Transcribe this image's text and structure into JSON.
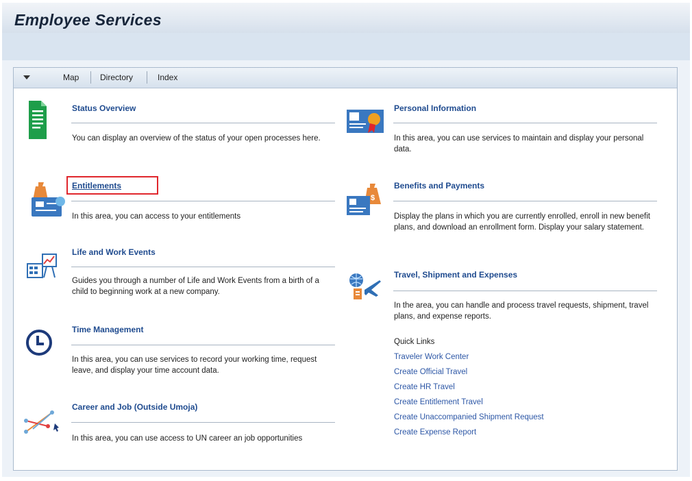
{
  "page": {
    "title": "Employee Services"
  },
  "toolbar": {
    "items": [
      "Map",
      "Directory",
      "Index"
    ]
  },
  "services_left": [
    {
      "title": "Status Overview",
      "desc": "You can display an overview of the status of your open processes here."
    },
    {
      "title": "Entitlements",
      "desc": "In this area, you can access to your entitlements"
    },
    {
      "title": "Life and Work Events",
      "desc": "Guides you through a number of Life and Work Events from a birth of a child to beginning work at a new company."
    },
    {
      "title": "Time Management",
      "desc": "In this area, you can use services to record your working time, request leave, and display your time account data."
    },
    {
      "title": "Career and Job (Outside Umoja)",
      "desc": "In this area, you can use access to UN career an job opportunities"
    }
  ],
  "services_right": [
    {
      "title": "Personal Information",
      "desc": "In this area, you can use services to maintain and display your personal data."
    },
    {
      "title": "Benefits and Payments",
      "desc": "Display the plans in which you are currently enrolled, enroll in new benefit plans, and download an enrollment form. Display your salary statement."
    },
    {
      "title": "Travel, Shipment and Expenses",
      "desc": "In the area, you can handle and process travel requests, shipment, travel plans, and expense reports."
    }
  ],
  "quick_links": {
    "label": "Quick Links",
    "items": [
      "Traveler Work Center",
      "Create Official Travel",
      "Create HR Travel",
      "Create Entitlement Travel",
      "Create Unaccompanied Shipment Request",
      "Create Expense Report"
    ]
  },
  "colors": {
    "link": "#1f4b8f",
    "highlight": "#e0262c",
    "quick_link": "#2d57a6"
  }
}
